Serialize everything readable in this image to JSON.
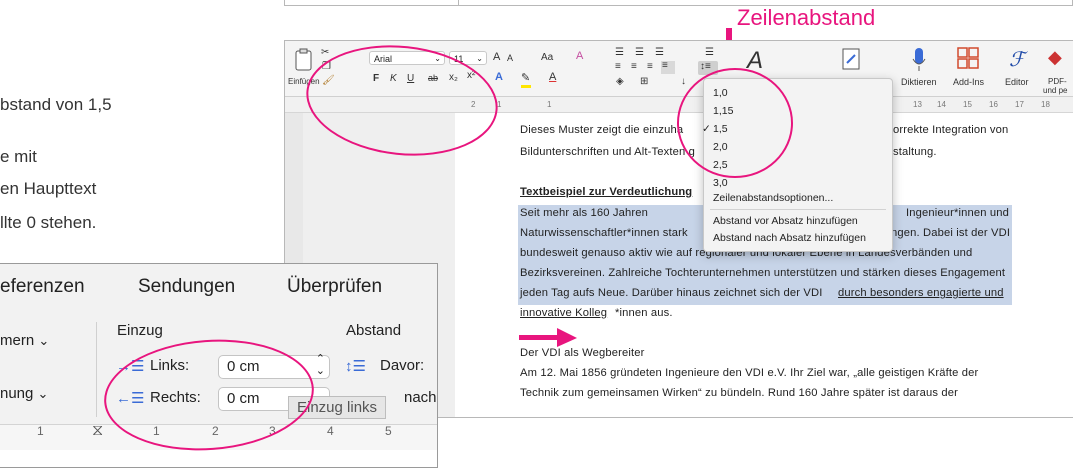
{
  "intro": {
    "line1": "bstand von 1,5",
    "line2": "e mit",
    "line3": "en Haupttext",
    "line4": "llte 0 stehen."
  },
  "annotation": {
    "label": "Zeilenabstand"
  },
  "ribbon": {
    "paste_label": "Einfügen",
    "font_name": "Arial",
    "font_size": "11",
    "bold": "F",
    "italic": "K",
    "underline": "U",
    "grow_font": "A",
    "shrink_font": "A",
    "case_label": "Aa",
    "dictate_label": "Diktieren",
    "addins_label": "Add-Ins",
    "editor_label": "Editor",
    "pdf_label_1": "PDF-",
    "pdf_label_2": "und pe"
  },
  "ruler": {
    "ticks": [
      "2",
      "1",
      "1",
      "13",
      "14",
      "15",
      "16",
      "17",
      "18"
    ]
  },
  "line_spacing_menu": {
    "options": [
      "1,0",
      "1,15",
      "1,5",
      "2,0",
      "2,5",
      "3,0"
    ],
    "selected": "1,5",
    "more_options": "Zeilenabstandsoptionen...",
    "add_before": "Abstand vor Absatz hinzufügen",
    "add_after": "Abstand nach Absatz hinzufügen"
  },
  "document": {
    "line1_a": "Dieses Muster zeigt die einzuha",
    "line1_b": "orrekte Integration von",
    "line2_a": "Bildunterschriften und Alt-Texten g",
    "line2_b": "staltung.",
    "heading": "Textbeispiel zur Verdeutlichung",
    "p1_a": "Seit mehr als 160 Jahren",
    "p1_b": "Ingenieur*innen und",
    "p2_a": "Naturwissenschaftler*innen stark",
    "p2_b": "ngen. Dabei ist der VDI",
    "p3": "bundesweit genauso aktiv wie auf regionaler und lokaler Ebene in Landesverbänden und",
    "p4": "Bezirksvereinen. Zahlreiche Tochterunternehmen unterstützen und stärken dieses Engagement",
    "p5_a": "jeden Tag aufs Neue. Darüber hinaus zeichnet sich der VDI",
    "p5_b": "durch besonders engagierte und",
    "p6_a": "innovative Kolleg",
    "p6_b": "*innen aus.",
    "section_title": "Der VDI als Wegbereiter",
    "s1": "Am 12. Mai 1856 gründeten Ingenieure den VDI e.V. Ihr Ziel war, „alle geistigen Kräfte der",
    "s2": "Technik zum gemeinsamen Wirken“ zu bündeln. Rund 160 Jahre später ist daraus der"
  },
  "paragraph_panel": {
    "tab_references": "eferenzen",
    "tab_mailings": "Sendungen",
    "tab_review": "Überprüfen",
    "numbering": "mern",
    "ordering": "nung",
    "indent_heading": "Einzug",
    "spacing_heading": "Abstand",
    "left_label": "Links:",
    "left_value": "0 cm",
    "right_label": "Rechts:",
    "right_value": "0 cm",
    "before_label": "Davor:",
    "after_partial": "nach",
    "tooltip": "Einzug links",
    "ruler_ticks": [
      "1",
      "1",
      "2",
      "3",
      "4",
      "5"
    ]
  },
  "colors": {
    "accent": "#e8157e",
    "highlight": "#c7d4e8"
  }
}
